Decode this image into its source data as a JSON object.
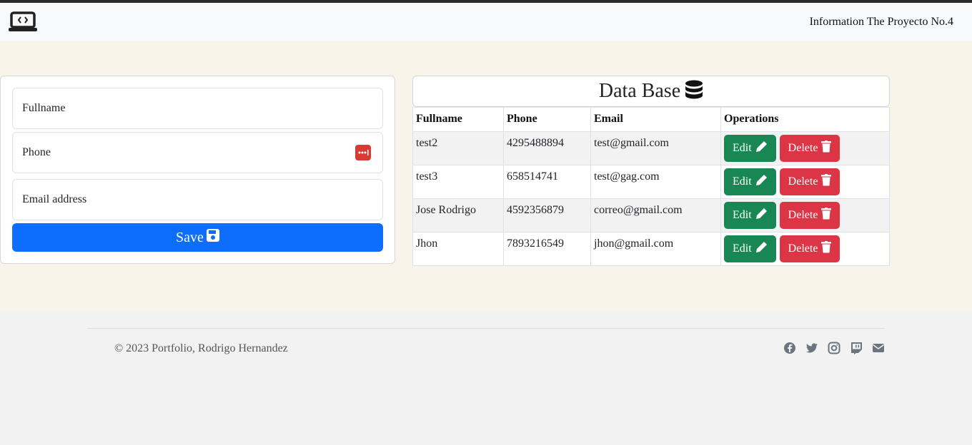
{
  "navbar": {
    "logo_icon": "laptop-code-icon",
    "title": "Information The Proyecto No.4"
  },
  "form": {
    "fullname_placeholder": "Fullname",
    "phone_placeholder": "Phone",
    "phone_icon": "password-manager-icon",
    "email_placeholder": "Email address",
    "save_label": "Save",
    "save_icon": "floppy-disk-icon",
    "save_color": "#0d6efd"
  },
  "database": {
    "title": "Data Base",
    "title_icon": "database-icon",
    "columns": [
      "Fullname",
      "Phone",
      "Email",
      "Operations"
    ],
    "rows": [
      {
        "fullname": "test2",
        "phone": "4295488894",
        "email": "test@gmail.com"
      },
      {
        "fullname": "test3",
        "phone": "658514741",
        "email": "test@gag.com"
      },
      {
        "fullname": "Jose Rodrigo",
        "phone": "4592356879",
        "email": "correo@gmail.com"
      },
      {
        "fullname": "Jhon",
        "phone": "7893216549",
        "email": "jhon@gmail.com"
      }
    ],
    "edit_label": "Edit",
    "edit_icon": "pencil-icon",
    "edit_color": "#198754",
    "delete_label": "Delete",
    "delete_icon": "trash-icon",
    "delete_color": "#dc3545"
  },
  "footer": {
    "copyright": "© 2023 Portfolio, Rodrigo Hernandez",
    "social_icons": [
      "facebook-icon",
      "twitter-icon",
      "instagram-icon",
      "twitch-icon",
      "envelope-icon"
    ]
  }
}
